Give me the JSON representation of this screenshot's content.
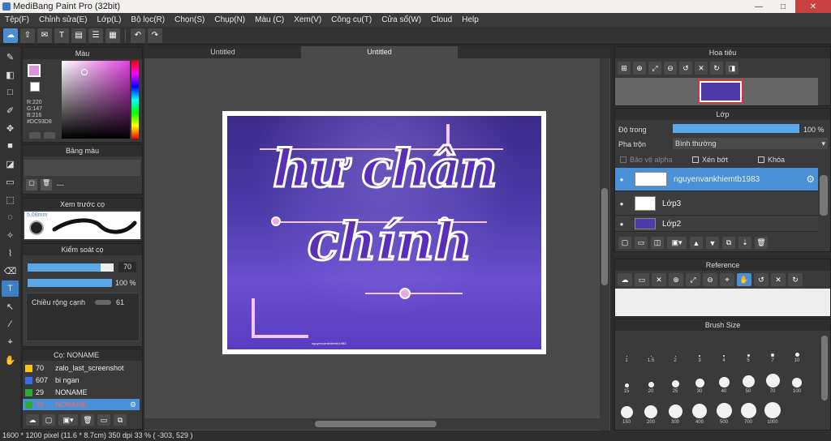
{
  "window": {
    "title": "MediBang Paint Pro (32bit)",
    "min": "—",
    "max": "□",
    "close": "✕"
  },
  "menu": [
    "Tệp(F)",
    "Chỉnh sửa(E)",
    "Lớp(L)",
    "Bộ lọc(R)",
    "Chọn(S)",
    "Chụp(N)",
    "Màu (C)",
    "Xem(V)",
    "Công cụ(T)",
    "Cửa sổ(W)",
    "Cloud",
    "Help"
  ],
  "tabs": [
    "Untitled",
    "Untitled"
  ],
  "color_panel": {
    "title": "Màu",
    "r": "R:220",
    "g": "G:147",
    "b": "B:216",
    "hex": "#DC93D8",
    "fg": "#DC93D8"
  },
  "palette_panel": {
    "title": "Bảng màu",
    "value": "---"
  },
  "brush_preview": {
    "title": "Xem trước cọ",
    "size": "5.08mm"
  },
  "brush_control": {
    "title": "Kiểm soát cọ",
    "size": "70",
    "opacity": "100 %",
    "smooth_label": "Chiều rộng cạnh",
    "smooth": "61"
  },
  "brushes": {
    "title": "Cọ: NONAME",
    "items": [
      {
        "num": "70",
        "name": "zalo_last_screenshot",
        "color": "#f5c518"
      },
      {
        "num": "607",
        "name": "bi ngan",
        "color": "#3a6ee8"
      },
      {
        "num": "29",
        "name": "NONAME",
        "color": "#2faa3a"
      },
      {
        "num": "70",
        "name": "NONAME",
        "color": "#2faa3a"
      }
    ]
  },
  "navigator": {
    "title": "Hoa tiêu"
  },
  "layers": {
    "title": "Lớp",
    "opacity_label": "Độ trong",
    "opacity": "100 %",
    "blend_label": "Pha trộn",
    "blend": "Bình thường",
    "protect_alpha": "Bảo vệ alpha",
    "clip": "Xén bớt",
    "lock": "Khóa",
    "items": [
      {
        "name": "nguyenvankhiemtb1983"
      },
      {
        "name": "Lớp3"
      },
      {
        "name": "Lớp2"
      }
    ]
  },
  "reference": {
    "title": "Reference"
  },
  "brush_size": {
    "title": "Brush Size",
    "sizes": [
      "1",
      "1.5",
      "2",
      "3",
      "4",
      "5",
      "7",
      "10",
      "15",
      "20",
      "25",
      "30",
      "40",
      "50",
      "70",
      "100",
      "150",
      "200",
      "300",
      "400",
      "500",
      "700",
      "1000"
    ]
  },
  "artwork": {
    "line1": "hư chân",
    "line2": "chính",
    "credit": "nguyenvankhiemtb1983"
  },
  "status": {
    "text": "1600 * 1200 pixel   (11.6 * 8.7cm)   350 dpi   33 %   ( -303, 529 )"
  }
}
